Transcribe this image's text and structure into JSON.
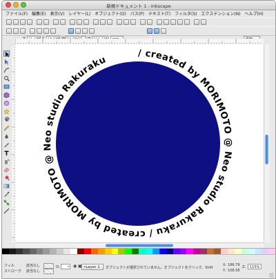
{
  "window": {
    "title": "新規ドキュメント 1 - Inkscape"
  },
  "menubar": {
    "items": [
      {
        "label": "ファイル(F)"
      },
      {
        "label": "編集(E)"
      },
      {
        "label": "表示(V)"
      },
      {
        "label": "レイヤー(L)"
      },
      {
        "label": "オブジェクト(O)"
      },
      {
        "label": "パス(P)"
      },
      {
        "label": "テキスト(T)"
      },
      {
        "label": "フィルタ(S)"
      },
      {
        "label": "エクステンション(N)"
      },
      {
        "label": "ヘルプ(H)"
      }
    ]
  },
  "toolbar2": {
    "x_label": "X",
    "x_value": "21.485",
    "y_label": "Y",
    "y_value": "18.588",
    "w_label": "W",
    "w_value": "64.98",
    "h_label": "H",
    "h_value": "154.270",
    "unit": "mm",
    "mode": "作用"
  },
  "status": {
    "fill_label": "フィル",
    "fill_value": "該当なし",
    "stroke_label": "ストローク",
    "stroke_value": "該当なし",
    "opacity_label": "O:",
    "layer": "•Layer 1",
    "message": "オブジェクトが選択されていません。オブジェクトをクリック、Shift",
    "x_label": "X:",
    "x_value": "186.79",
    "y_label": "Y:",
    "y_value": "108.56",
    "zoom_label": "Z:",
    "zoom_value": "115%"
  },
  "canvas": {
    "circle_color": "#0e0f82",
    "circular_text": "/ created by MORIMOTO @ Neo studio Rakuraku / created by MORIMOTO @ Neo studio Rakuraku "
  },
  "palette_colors": [
    "#000000",
    "#1a1a1a",
    "#333333",
    "#4d4d4d",
    "#666666",
    "#808080",
    "#999999",
    "#b3b3b3",
    "#cccccc",
    "#e6e6e6",
    "#ffffff",
    "#800000",
    "#ff0000",
    "#ff6600",
    "#ff9900",
    "#ffcc00",
    "#ffff00",
    "#99cc00",
    "#00ff00",
    "#008000",
    "#00ffcc",
    "#00ffff",
    "#0099ff",
    "#0000ff",
    "#000080",
    "#6600ff",
    "#9900ff",
    "#ff00ff",
    "#cc0099",
    "#993366",
    "#c87137",
    "#a05a2c",
    "#ffcccc",
    "#ffe6cc",
    "#ffffcc",
    "#ccffcc",
    "#ccffff",
    "#cce5ff",
    "#e5ccff",
    "#ffccf2"
  ]
}
